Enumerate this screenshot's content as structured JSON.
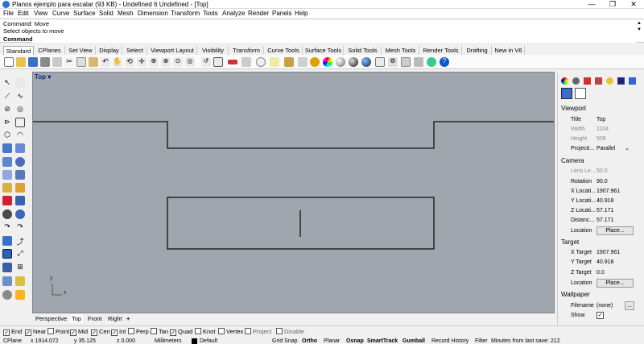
{
  "window": {
    "title": "Planos ejemplo para escalar (93 KB) - Undefined 6 Undefined - [Top]",
    "minimize": "—",
    "maximize": "❐",
    "close": "✕"
  },
  "menu": [
    "File",
    "Edit",
    "View",
    "Curve",
    "Surface",
    "Solid",
    "Mesh",
    "Dimension",
    "Transform",
    "Tools",
    "Analyze",
    "Render",
    "Panels",
    "Help"
  ],
  "command": {
    "history1": "Command: Move",
    "history2": "Select objects to move",
    "prompt": "Command:",
    "value": ""
  },
  "toolbar_tabs": [
    "Standard",
    "CPlanes",
    "Set View",
    "Display",
    "Select",
    "Viewport Layout",
    "Visibility",
    "Transform",
    "Curve Tools",
    "Surface Tools",
    "Solid Tools",
    "Mesh Tools",
    "Render Tools",
    "Drafting",
    "New in V6"
  ],
  "viewport": {
    "label": "Top",
    "dropdown": "▾",
    "axis_x": "x",
    "axis_y": "y"
  },
  "viewport_tabs": [
    "Perspective",
    "Top",
    "Front",
    "Right"
  ],
  "viewport_tab_add": "+",
  "osnaps": [
    {
      "label": "End",
      "checked": true
    },
    {
      "label": "Near",
      "checked": true
    },
    {
      "label": "Point",
      "checked": false
    },
    {
      "label": "Mid",
      "checked": true
    },
    {
      "label": "Cen",
      "checked": true
    },
    {
      "label": "Int",
      "checked": true
    },
    {
      "label": "Perp",
      "checked": false
    },
    {
      "label": "Tan",
      "checked": false
    },
    {
      "label": "Quad",
      "checked": true
    },
    {
      "label": "Knot",
      "checked": false
    },
    {
      "label": "Vertex",
      "checked": false
    },
    {
      "label": "Project",
      "checked": false
    },
    {
      "label": "Disable",
      "checked": false
    }
  ],
  "status": {
    "cplane": "CPlane",
    "x": "x 1914.072",
    "y": "y 35.125",
    "z": "z 0.000",
    "units": "Millimeters",
    "layer": "Default",
    "grid_snap": "Grid Snap",
    "ortho": "Ortho",
    "planar": "Planar",
    "osnap": "Osnap",
    "smarttrack": "SmartTrack",
    "gumball": "Gumball",
    "record_history": "Record History",
    "filter": "Filter",
    "minutes": "Minutes from last save: 212"
  },
  "properties": {
    "viewport_header": "Viewport",
    "camera_header": "Camera",
    "target_header": "Target",
    "wallpaper_header": "Wallpaper",
    "rows": {
      "title_label": "Title",
      "title_value": "Top",
      "width_label": "Width",
      "width_value": "1104",
      "height_label": "Height",
      "height_value": "508",
      "projection_label": "Projecti...",
      "projection_value": "Parallel",
      "lens_label": "Lens Le...",
      "lens_value": "50.0",
      "rotation_label": "Rotation",
      "rotation_value": "90.0",
      "xloc_label": "X Locati...",
      "xloc_value": "1907.961",
      "yloc_label": "Y Locati...",
      "yloc_value": "40.918",
      "zloc_label": "Z Locati...",
      "zloc_value": "57.171",
      "distance_label": "Distanc...",
      "distance_value": "57.171",
      "cam_location_label": "Location",
      "cam_place": "Place...",
      "xtarget_label": "X Target",
      "xtarget_value": "1907.961",
      "ytarget_label": "Y Target",
      "ytarget_value": "40.918",
      "ztarget_label": "Z Target",
      "ztarget_value": "0.0",
      "tgt_location_label": "Location",
      "tgt_place": "Place...",
      "filename_label": "Filename",
      "filename_value": "(none)",
      "filename_btn": "...",
      "show_label": "Show",
      "show_value": "✓"
    }
  }
}
